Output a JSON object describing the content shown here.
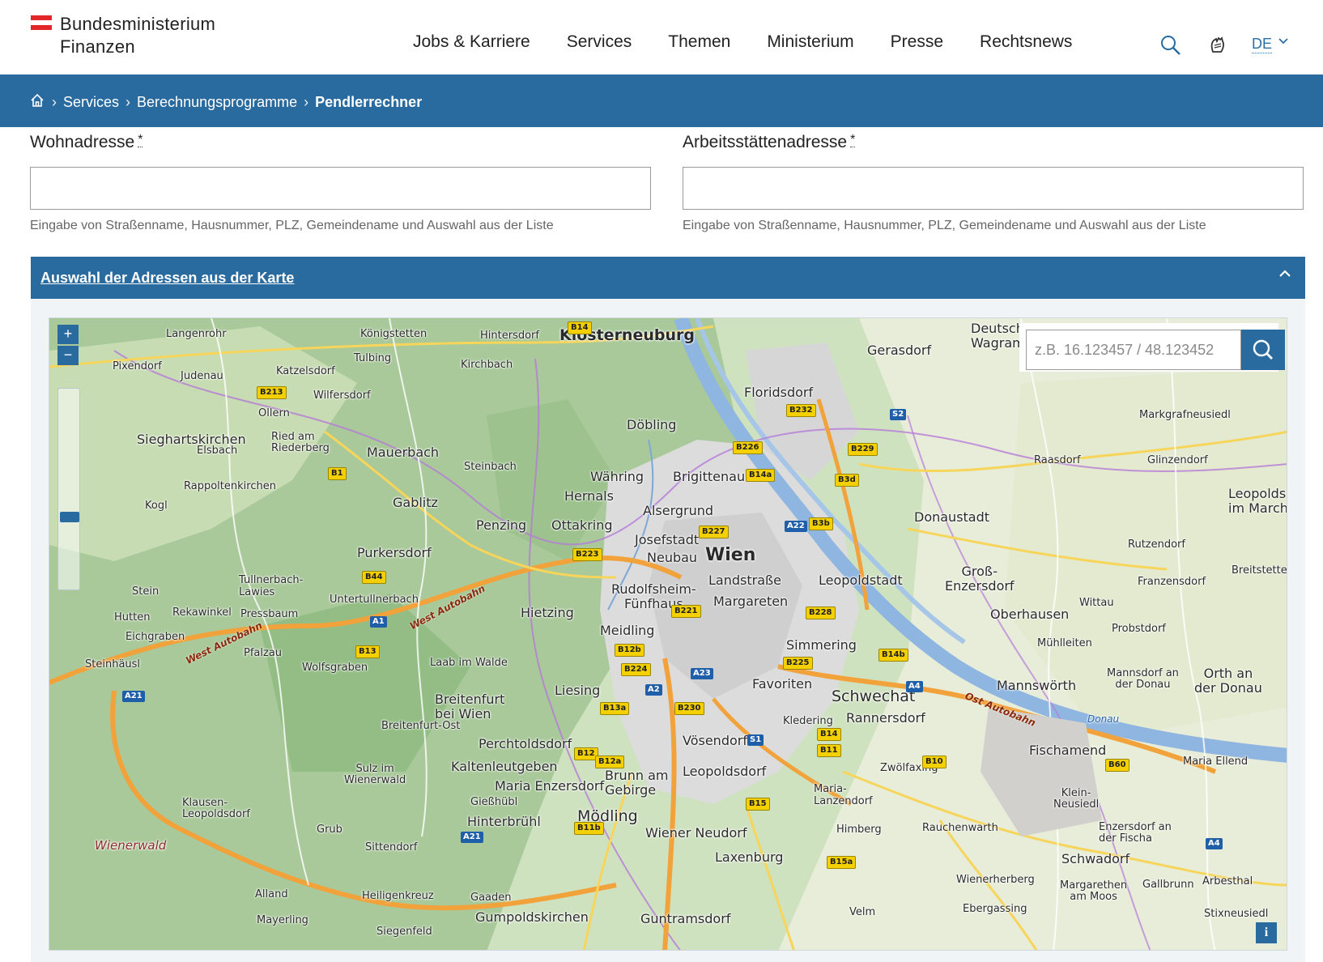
{
  "header": {
    "logo_line1": "Bundesministerium",
    "logo_line2": "Finanzen",
    "nav": [
      "Jobs & Karriere",
      "Services",
      "Themen",
      "Ministerium",
      "Presse",
      "Rechtsnews"
    ],
    "lang": "DE"
  },
  "breadcrumb": {
    "items": [
      "Services",
      "Berechnungsprogramme"
    ],
    "current": "Pendlerrechner"
  },
  "form": {
    "wohn": {
      "label": "Wohnadresse",
      "required": "*",
      "value": "",
      "help": "Eingabe von Straßenname, Hausnummer, PLZ, Gemeindename und Auswahl aus der Liste"
    },
    "arbeit": {
      "label": "Arbeitsstättenadresse",
      "required": "*",
      "value": "",
      "help": "Eingabe von Straßenname, Hausnummer, PLZ, Gemeindename und Auswahl aus der Liste"
    }
  },
  "map_panel": {
    "title": "Auswahl der Adressen aus der Karte",
    "coord_placeholder": "z.B. 16.123457 / 48.123452",
    "zoom_in": "+",
    "zoom_out": "−",
    "info": "i",
    "labels": {
      "wien": "Wien",
      "klosterneuburg": "Klosterneuburg",
      "floridsdorf": "Floridsdorf",
      "doebling": "Döbling",
      "waehring": "Währing",
      "brigittenau": "Brigittenau",
      "hernals": "Hernals",
      "alsergrund": "Alsergrund",
      "josefstadt": "Josefstadt",
      "neubau": "Neubau",
      "ottakring": "Ottakring",
      "penzing": "Penzing",
      "landstrasse": "Landstraße",
      "leopoldstadt": "Leopoldstadt",
      "donaustadt": "Donaustadt",
      "rudolfsheim": "Rudolfsheim-\nFünfhaus",
      "margareten": "Margareten",
      "hietzing": "Hietzing",
      "meidling": "Meidling",
      "simmering": "Simmering",
      "favoriten": "Favoriten",
      "schwechat": "Schwechat",
      "liesing": "Liesing",
      "moedling": "Mödling",
      "gerasdorf": "Gerasdorf",
      "purkersdorf": "Purkersdorf",
      "gablitz": "Gablitz",
      "mauerbach": "Mauerbach",
      "sieghartskirchen": "Sieghartskirchen",
      "fischamend": "Fischamend",
      "grossenzersdorf": "Groß-\nEnzersdorf",
      "voesendorf": "Vösendorf",
      "leopoldsdorf": "Leopoldsdorf",
      "laxenburg": "Laxenburg",
      "perchtoldsdorf": "Perchtoldsdorf",
      "kaltenleutgeben": "Kaltenleutgeben",
      "breitenfurt": "Breitenfurt\nbei Wien",
      "brunn": "Brunn am\nGebirge",
      "wiener_neudorf": "Wiener Neudorf",
      "gumpoldskirchen": "Gumpoldskirchen",
      "guntramsdorf": "Guntramsdorf",
      "maria_enzersdorf": "Maria Enzersdorf",
      "hinterbruehl": "Hinterbrühl",
      "giesshuebl": "Gießhübl",
      "tullnerbach": "Tullnerbach-\nLawies",
      "pressbaum": "Pressbaum",
      "mannswoerth": "Mannswörth",
      "rannersdorf": "Rannersdorf",
      "oberhausen": "Oberhausen",
      "raasdorf": "Raasdorf",
      "glinzendorf": "Glinzendorf",
      "markgrafneusiedl": "Markgrafneusiedl",
      "orth": "Orth an\nder Donau",
      "leopoldsdorf_march": "Leopolds\nim March",
      "wienerwald": "Wienerwald",
      "west_autobahn": "West Autobahn",
      "ost_autobahn": "Ost Autobahn",
      "donau": "Donau",
      "katzelsdorf": "Katzelsdorf",
      "koenigstetten": "Königstetten",
      "tulbing": "Tulbing",
      "kirchbach": "Kirchbach",
      "hintersdorf": "Hintersdorf",
      "langenrohr": "Langenrohr",
      "pixendorf": "Pixendorf",
      "judenau": "Judenau",
      "wilfersdorf": "Wilfersdorf",
      "ollern": "Ollern",
      "ried": "Ried am\nRiederberg",
      "elsbach": "Elsbach",
      "rappoltenkirchen": "Rappoltenkirchen",
      "kogl": "Kogl",
      "steinbach": "Steinbach",
      "stein": "Stein",
      "rekawinkel": "Rekawinkel",
      "untertullnerbach": "Untertullnerbach",
      "hutten": "Hutten",
      "eichgraben": "Eichgraben",
      "pfalzau": "Pfalzau",
      "wolfsgraben": "Wolfsgraben",
      "laab": "Laab im Walde",
      "steinhaeusl": "Steinhäusl",
      "breitenfurt_ost": "Breitenfurt-Ost",
      "sulz": "Sulz im\nWienerwald",
      "klausen": "Klausen-\nLeopoldsdorf",
      "grub": "Grub",
      "sittendorf": "Sittendorf",
      "alland": "Alland",
      "heiligenkreuz": "Heiligenkreuz",
      "gaaden": "Gaaden",
      "mayerling": "Mayerling",
      "siegenfeld": "Siegenfeld",
      "kledering": "Kledering",
      "zwoelfaxing": "Zwölfaxing",
      "maria_lanzendorf": "Maria-\nLanzendorf",
      "himberg": "Himberg",
      "rauchenwarth": "Rauchenwarth",
      "wienerherberg": "Wienerherberg",
      "ebergassing": "Ebergassing",
      "velm": "Velm",
      "schwadorf": "Schwadorf",
      "klein_neusiedl": "Klein-\nNeusiedl",
      "enzersdorf_fischa": "Enzersdorf an\nder Fischa",
      "margarethen": "Margarethen\nam Moos",
      "gallbrunn": "Gallbrunn",
      "arbesthal": "Arbesthal",
      "stixneusiedl": "Stixneusiedl",
      "maria_ellend": "Maria Ellend",
      "muehlleiten": "Mühlleiten",
      "probstdorf": "Probstdorf",
      "mannsdorf": "Mannsdorf an\nder Donau",
      "wittau": "Wittau",
      "franzensdorf": "Franzensdorf",
      "rutzendorf": "Rutzendorf",
      "breitstetten": "Breitstette",
      "deutsch_wagram": "Deutsch\nWagram"
    }
  },
  "colors": {
    "brand_blue": "#2a6b9f",
    "flag_red": "#e2262a"
  }
}
